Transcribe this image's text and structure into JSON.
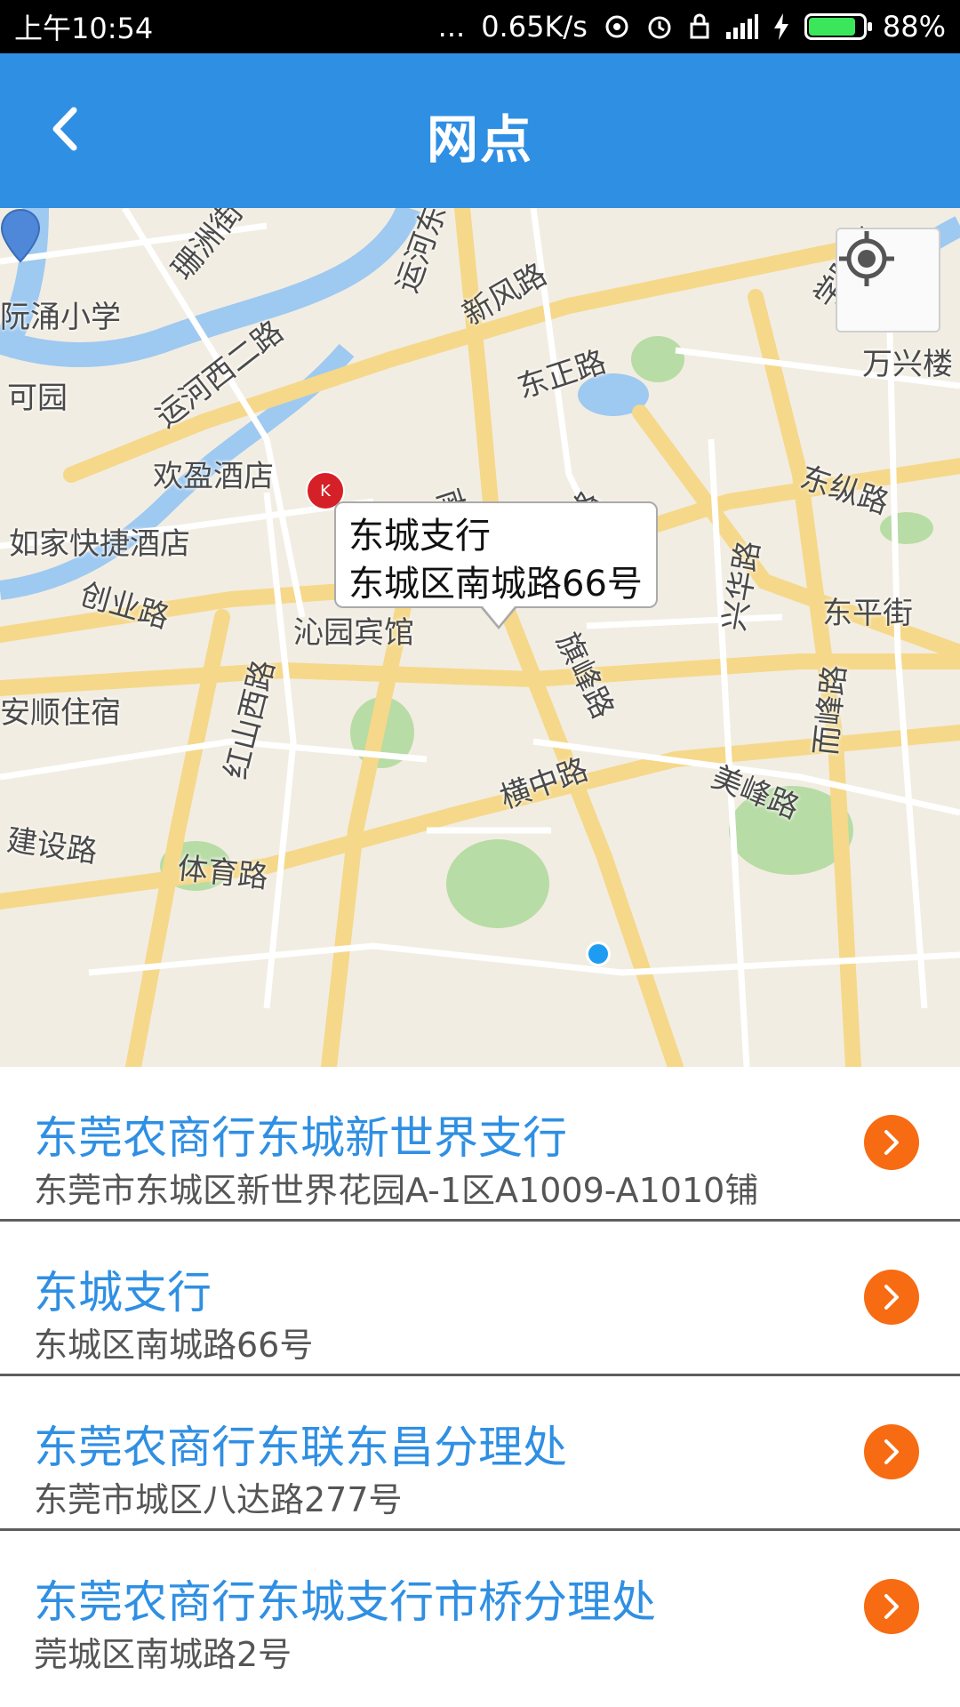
{
  "status_bar": {
    "time": "上午10:54",
    "dots": "...",
    "speed": "0.65K/s",
    "battery_level": 0.88,
    "battery_text": "88%",
    "battery_color": "#3be75a"
  },
  "header": {
    "title": "网点",
    "background": "#2f8fe3"
  },
  "map": {
    "labels": [
      "珊洲街",
      "运河东",
      "新风路",
      "阮涌小学",
      "可园",
      "运河西二路",
      "东正路",
      "万兴楼",
      "欢盈酒店",
      "东纵路",
      "如家快捷酒店",
      "南门路",
      "罗沙路",
      "兴华路",
      "东平街",
      "创业路",
      "沁园宾馆",
      "旗峰路",
      "安顺住宿",
      "红山西路",
      "而峰路",
      "横中路",
      "美峰路",
      "建设路",
      "体育路",
      "学院路"
    ],
    "callout": {
      "name": "东城支行",
      "address": "东城区南城路66号"
    }
  },
  "branches": [
    {
      "name": "东莞农商行东城新世界支行",
      "address": "东莞市东城区新世界花园A-1区A1009-A1010铺"
    },
    {
      "name": "东城支行",
      "address": "东城区南城路66号"
    },
    {
      "name": "东莞农商行东联东昌分理处",
      "address": "东莞市城区八达路277号"
    },
    {
      "name": "东莞农商行东城支行市桥分理处",
      "address": "莞城区南城路2号"
    }
  ],
  "colors": {
    "accent": "#2f8fe3",
    "arrow": "#f76b12"
  }
}
